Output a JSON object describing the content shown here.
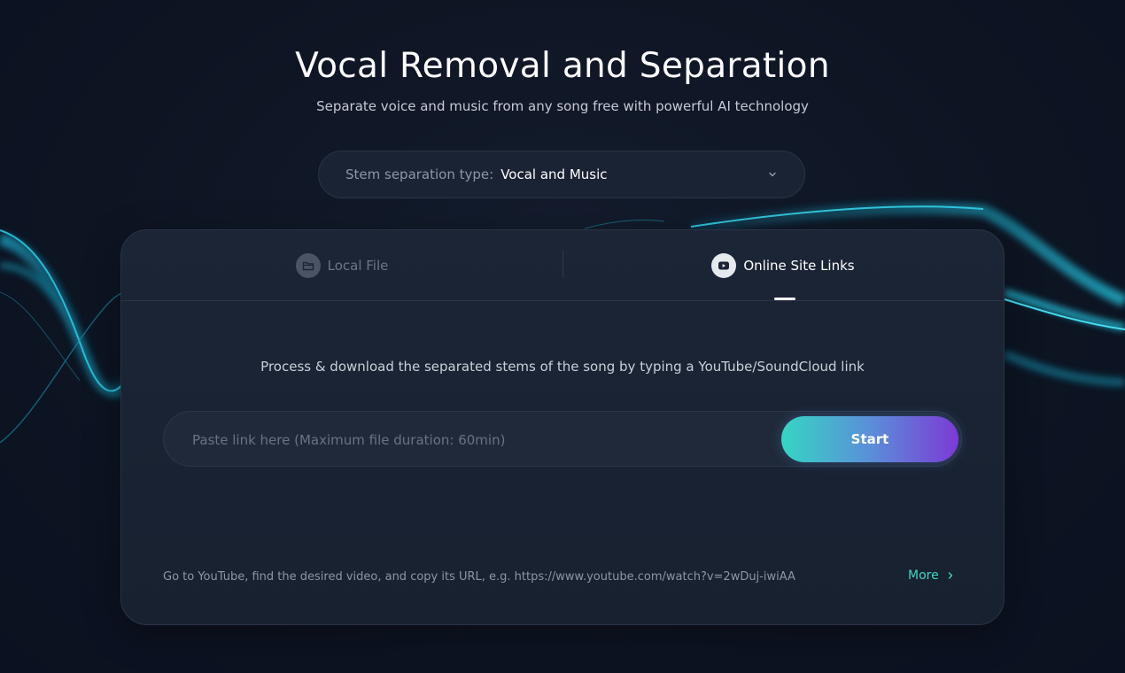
{
  "header": {
    "title": "Vocal Removal and Separation",
    "subtitle": "Separate voice and music from any song free with powerful AI technology"
  },
  "stem_select": {
    "label": "Stem separation type:",
    "value": "Vocal and Music"
  },
  "tabs": [
    {
      "label": "Local File",
      "icon": "folder-icon",
      "active": false
    },
    {
      "label": "Online Site Links",
      "icon": "youtube-play-icon",
      "active": true
    }
  ],
  "online": {
    "instruction": "Process & download the separated stems of the song by typing a YouTube/SoundCloud link",
    "input_placeholder": "Paste link here (Maximum file duration: 60min)",
    "start_label": "Start",
    "hint": "Go to YouTube, find the desired video, and copy its URL, e.g. https://www.youtube.com/watch?v=2wDuj-iwiAA",
    "more_label": "More"
  },
  "colors": {
    "accent_teal": "#3ed8c4",
    "accent_purple": "#7c3ad6",
    "background": "#0d1422"
  }
}
